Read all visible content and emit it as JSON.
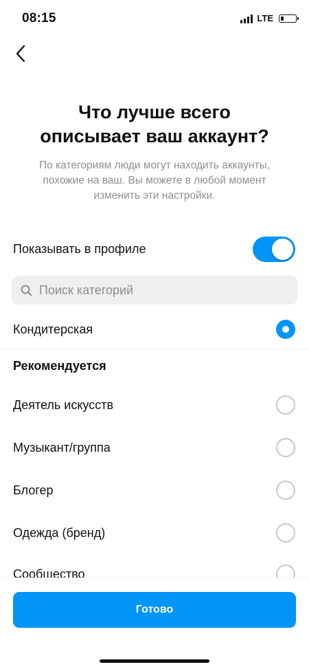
{
  "status_bar": {
    "time": "08:15",
    "network": "LTE"
  },
  "header": {
    "title": "Что лучше всего описывает ваш аккаунт?",
    "subtitle": "По категориям люди могут находить аккаунты, похожие на ваш. Вы можете в любой момент изменить эти настройки."
  },
  "profile_toggle": {
    "label": "Показывать в профиле",
    "on": true
  },
  "search": {
    "placeholder": "Поиск категорий",
    "value": ""
  },
  "selected_category": {
    "label": "Кондитерская",
    "selected": true
  },
  "recommended": {
    "title": "Рекомендуется",
    "items": [
      {
        "label": "Деятель искусств",
        "selected": false
      },
      {
        "label": "Музыкант/группа",
        "selected": false
      },
      {
        "label": "Блогер",
        "selected": false
      },
      {
        "label": "Одежда (бренд)",
        "selected": false
      },
      {
        "label": "Сообщество",
        "selected": false
      }
    ]
  },
  "actions": {
    "done_label": "Готово"
  },
  "colors": {
    "accent": "#0095f6",
    "text_primary": "#111111",
    "text_secondary": "#8e8e8e",
    "search_bg": "#efefef"
  },
  "icons": {
    "back": "chevron-left-icon",
    "search": "search-icon"
  }
}
